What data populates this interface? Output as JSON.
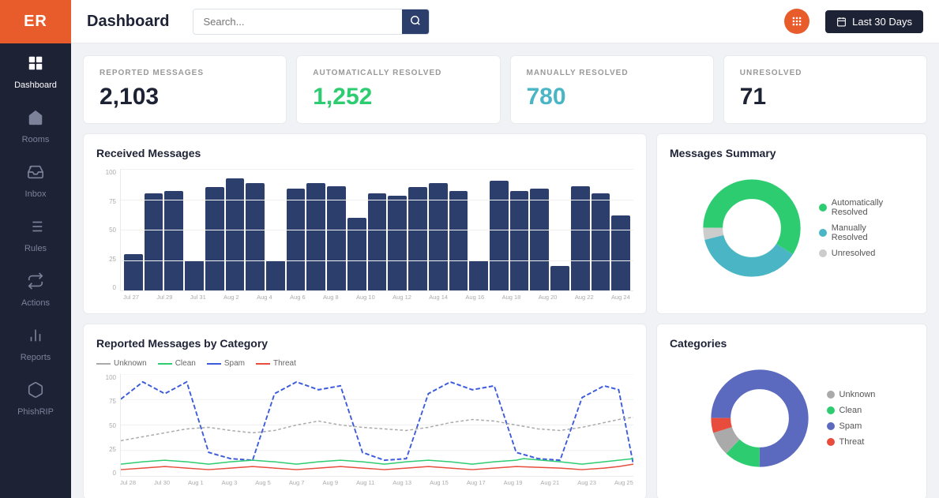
{
  "app": {
    "logo": "ER",
    "logo_bg": "#e85c2c"
  },
  "header": {
    "title": "Dashboard",
    "search_placeholder": "Search...",
    "date_range": "Last 30 Days",
    "date_icon": "📅"
  },
  "sidebar": {
    "items": [
      {
        "id": "dashboard",
        "label": "Dashboard",
        "icon": "📊",
        "active": true
      },
      {
        "id": "rooms",
        "label": "Rooms",
        "icon": "🏠",
        "active": false
      },
      {
        "id": "inbox",
        "label": "Inbox",
        "icon": "📥",
        "active": false
      },
      {
        "id": "rules",
        "label": "Rules",
        "icon": "📋",
        "active": false
      },
      {
        "id": "actions",
        "label": "Actions",
        "icon": "⇄",
        "active": false
      },
      {
        "id": "reports",
        "label": "Reports",
        "icon": "📈",
        "active": false
      },
      {
        "id": "phishrip",
        "label": "PhishRIP",
        "icon": "🐟",
        "active": false
      }
    ]
  },
  "stats": [
    {
      "id": "reported",
      "label": "REPORTED MESSAGES",
      "value": "2,103",
      "color": "dark"
    },
    {
      "id": "auto_resolved",
      "label": "AUTOMATICALLY RESOLVED",
      "value": "1,252",
      "color": "green"
    },
    {
      "id": "manually_resolved",
      "label": "MANUALLY RESOLVED",
      "value": "780",
      "color": "teal"
    },
    {
      "id": "unresolved",
      "label": "UNRESOLVED",
      "value": "71",
      "color": "dark"
    }
  ],
  "received_messages": {
    "title": "Received Messages",
    "y_labels": [
      "100",
      "75",
      "50",
      "25",
      "0"
    ],
    "x_labels": [
      "Jul 27",
      "Jul 29",
      "Jul 31",
      "Aug 2",
      "Aug 4",
      "Aug 6",
      "Aug 8",
      "Aug 10",
      "Aug 12",
      "Aug 14",
      "Aug 16",
      "Aug 18",
      "Aug 20",
      "Aug 22",
      "Aug 24"
    ],
    "bars": [
      30,
      80,
      82,
      25,
      85,
      92,
      88,
      25,
      84,
      88,
      86,
      60,
      80,
      78,
      85,
      88,
      82,
      25,
      90,
      82,
      84,
      20,
      86,
      80,
      62
    ]
  },
  "messages_summary": {
    "title": "Messages Summary",
    "legend": [
      {
        "label": "Automatically Resolved",
        "color": "#2ecc71"
      },
      {
        "label": "Manually Resolved",
        "color": "#4ab5c4"
      },
      {
        "label": "Unresolved",
        "color": "#ccc"
      }
    ],
    "segments": [
      {
        "label": "Auto",
        "pct": 59,
        "color": "#2ecc71"
      },
      {
        "label": "Manual",
        "pct": 37,
        "color": "#4ab5c4"
      },
      {
        "label": "Unresolved",
        "pct": 4,
        "color": "#ccc"
      }
    ]
  },
  "reported_by_category": {
    "title": "Reported Messages by Category",
    "legend": [
      {
        "label": "Unknown",
        "color": "#aaa",
        "style": "dashed"
      },
      {
        "label": "Clean",
        "color": "#2ecc71",
        "style": "solid"
      },
      {
        "label": "Spam",
        "color": "#3b5bdb",
        "style": "dashed2"
      },
      {
        "label": "Threat",
        "color": "#e74c3c",
        "style": "solid"
      }
    ],
    "x_labels": [
      "Jul 28",
      "Jul 30",
      "Aug 1",
      "Aug 3",
      "Aug 5",
      "Aug 7",
      "Aug 9",
      "Aug 11",
      "Aug 13",
      "Aug 15",
      "Aug 17",
      "Aug 19",
      "Aug 21",
      "Aug 23",
      "Aug 25"
    ]
  },
  "categories": {
    "title": "Categories",
    "legend": [
      {
        "label": "Unknown",
        "color": "#aaa"
      },
      {
        "label": "Clean",
        "color": "#2ecc71"
      },
      {
        "label": "Spam",
        "color": "#5b6abf"
      },
      {
        "label": "Threat",
        "color": "#e74c3c"
      }
    ],
    "segments": [
      {
        "label": "Spam",
        "pct": 75,
        "color": "#5b6abf"
      },
      {
        "label": "Clean",
        "pct": 12,
        "color": "#2ecc71"
      },
      {
        "label": "Unknown",
        "pct": 8,
        "color": "#aaa"
      },
      {
        "label": "Threat",
        "pct": 5,
        "color": "#e74c3c"
      }
    ]
  }
}
